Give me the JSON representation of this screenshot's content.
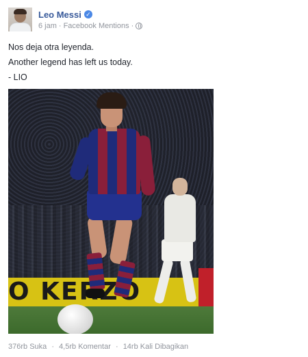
{
  "post": {
    "author": "Leo Messi",
    "verified_mark": "✓",
    "time": "6 jam",
    "separator": "·",
    "source": "Facebook Mentions",
    "lines": [
      "Nos deja otra leyenda.",
      "Another legend has left us today.",
      "- LIO"
    ]
  },
  "photo": {
    "banner_text": "O KERZO"
  },
  "stats": {
    "likes": "376rb Suka",
    "comments": "4,5rb Komentar",
    "shares": "14rb Kali Dibagikan"
  },
  "icons": {
    "verified": "verified-badge-icon",
    "privacy": "globe-icon"
  },
  "colors": {
    "name": "#365899",
    "meta": "#90949c",
    "verified": "#4b88e6"
  }
}
